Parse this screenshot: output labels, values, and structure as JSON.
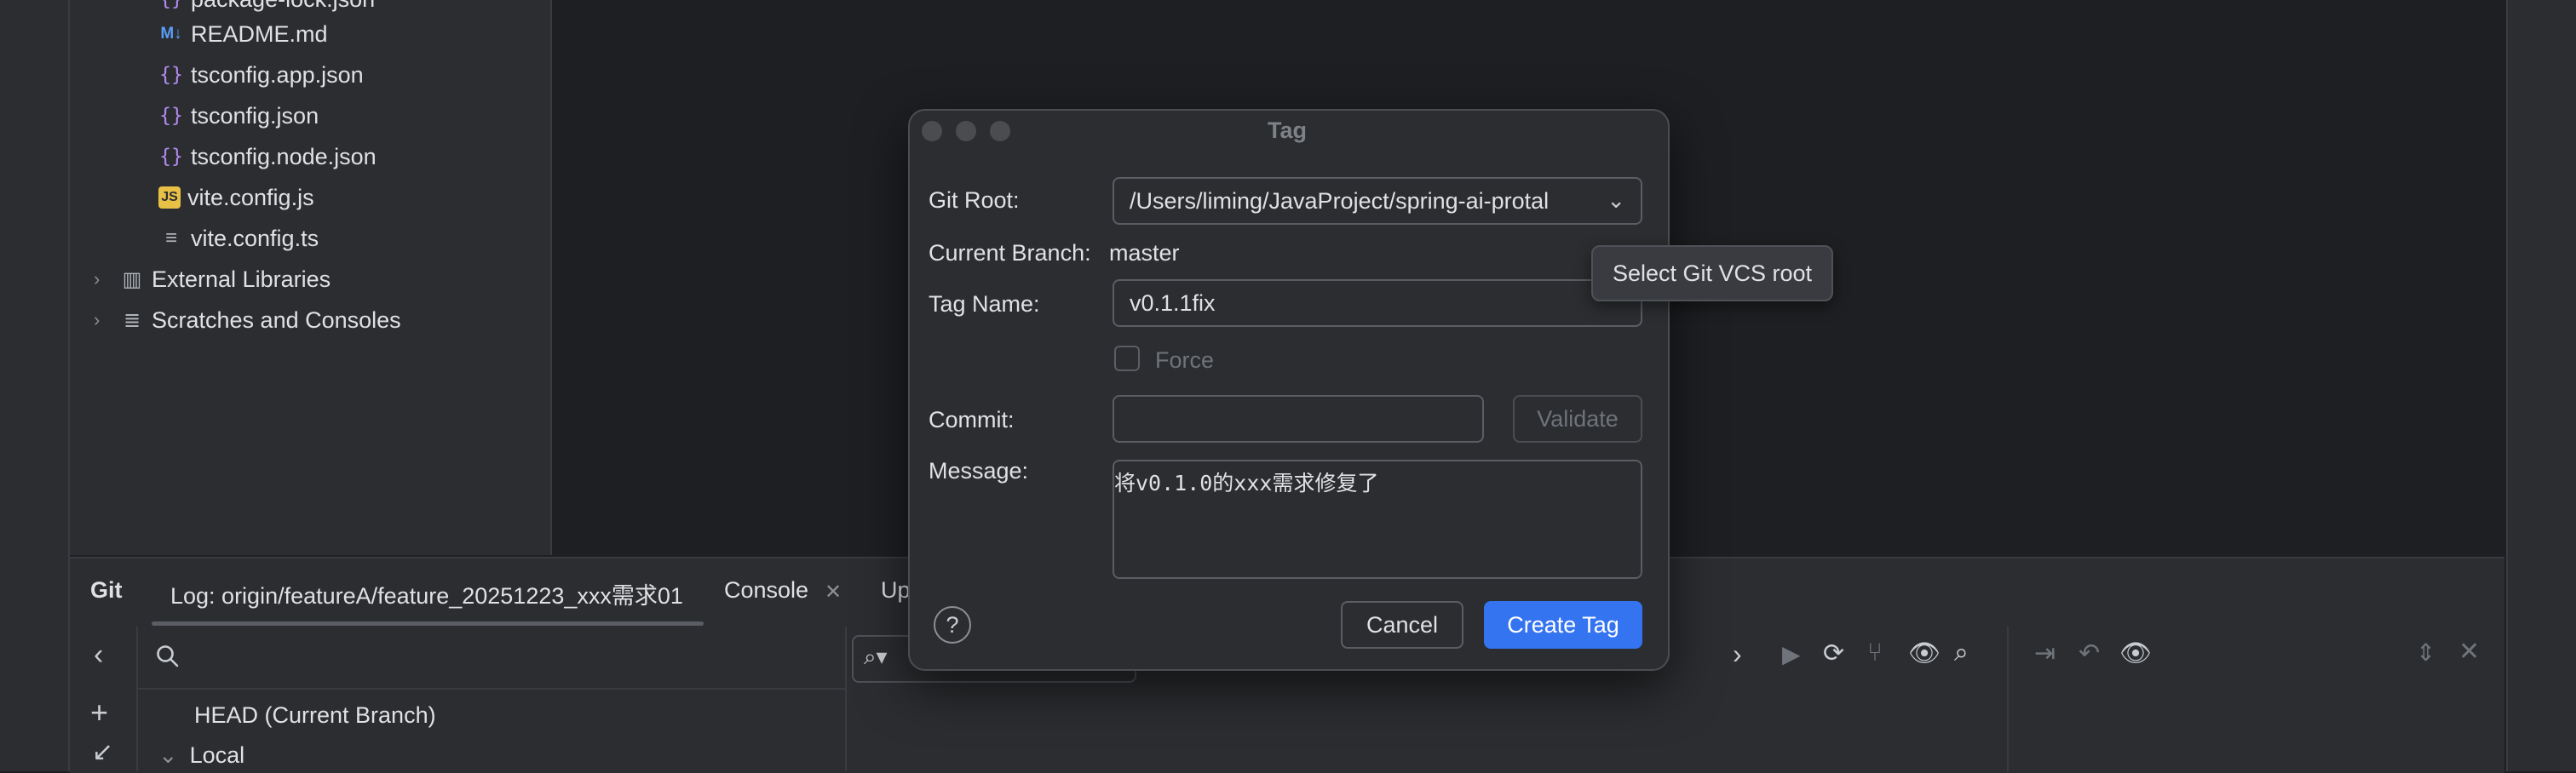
{
  "project_tree": {
    "files": [
      {
        "name": "package-lock.json",
        "icon": "json-file-icon"
      },
      {
        "name": "README.md",
        "icon": "markdown-file-icon"
      },
      {
        "name": "tsconfig.app.json",
        "icon": "json-file-icon"
      },
      {
        "name": "tsconfig.json",
        "icon": "json-file-icon"
      },
      {
        "name": "tsconfig.node.json",
        "icon": "json-file-icon"
      },
      {
        "name": "vite.config.js",
        "icon": "js-file-icon"
      },
      {
        "name": "vite.config.ts",
        "icon": "text-file-icon"
      }
    ],
    "external_libraries": "External Libraries",
    "scratches": "Scratches and Consoles"
  },
  "bottom_panel": {
    "title": "Git",
    "tabs": [
      {
        "label": "Log: origin/featureA/feature_20251223_xxx需求01"
      },
      {
        "label": "Console"
      },
      {
        "label": "Up"
      }
    ],
    "branches": {
      "head": "HEAD (Current Branch)",
      "local": "Local"
    }
  },
  "dialog": {
    "title": "Tag",
    "git_root_label": "Git Root:",
    "git_root_value": "/Users/liming/JavaProject/spring-ai-protal",
    "current_branch_label": "Current Branch:",
    "current_branch_value": "master",
    "tag_name_label": "Tag Name:",
    "tag_name_value": "v0.1.1fix",
    "force_label": "Force",
    "commit_label": "Commit:",
    "commit_value": "",
    "validate_label": "Validate",
    "message_label": "Message:",
    "message_value": "将v0.1.0的xxx需求修复了",
    "help_label": "?",
    "cancel_label": "Cancel",
    "create_label": "Create Tag"
  },
  "tooltip": {
    "text": "Select Git VCS root"
  },
  "colors": {
    "background": "#1e1f22",
    "panel": "#2b2d30",
    "accent": "#3574f0",
    "text": "#dfe1e5"
  }
}
